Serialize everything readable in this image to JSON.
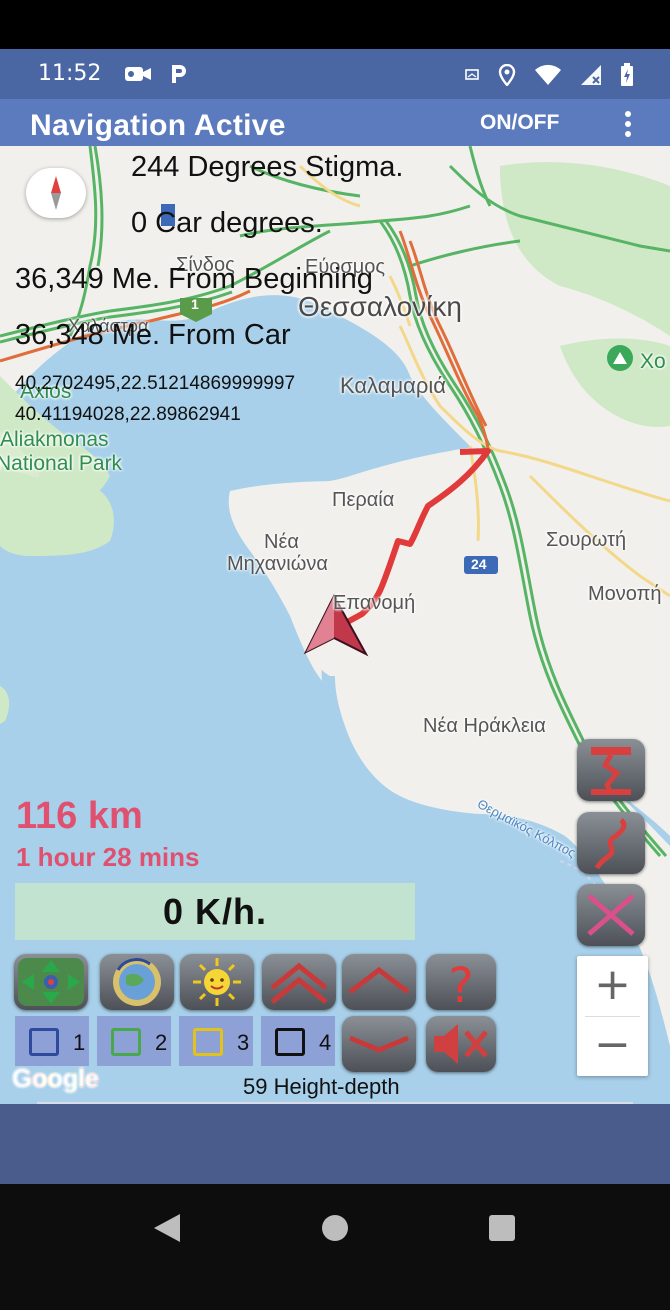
{
  "status_bar": {
    "time": "11:52",
    "left_icons": [
      "video-camera-icon",
      "parking-icon"
    ],
    "right_icons": [
      "cast-icon",
      "location-icon",
      "wifi-icon",
      "signal-icon",
      "battery-icon"
    ]
  },
  "app_bar": {
    "title": "Navigation Active",
    "action_label": "ON/OFF",
    "overflow_icon": "more-vert-icon",
    "color": "#5c7bbf"
  },
  "overlay": {
    "degrees_stigma": "244 Degrees Stigma.",
    "car_degrees": "0 Car degrees.",
    "from_beginning": "36,349 Me. From Beginning",
    "from_car": "36,348 Me. From Car",
    "coord_1": "40,2702495,22.51214869999997",
    "coord_2": "40.41194028,22.89862941"
  },
  "map": {
    "places": {
      "sindos": "Σίνδος",
      "evosmos": "Εύοσμος",
      "thessaloniki": "Θεσσαλονίκη",
      "kalamaria": "Καλαμαριά",
      "chalastra": "Χαλάστρα",
      "axios": "Axios",
      "axios2": "Aliakmonas",
      "national_park": "National Park",
      "peraia": "Περαία",
      "nea": "Νέα",
      "michaniona": "Μηχανιώνα",
      "epanomi": "Επανομή",
      "sourototi": "Σουρωτή",
      "monopigado": "Μονοπή",
      "nea_irakleia": "Νέα Ηράκλεια",
      "thermaikos": "Θερμαϊκός Κόλπος",
      "chortiatis": "Χο",
      "road_1": "1",
      "road_24": "24"
    },
    "route_color": "#e03a3a"
  },
  "trip": {
    "distance": "116 km",
    "duration": "1 hour 28 mins",
    "speed": "0  K/h."
  },
  "toolbar": {
    "row1": [
      "center-map-icon",
      "rotate-globe-icon",
      "sun-icon",
      "double-chevron-up-icon",
      "chevron-up-icon",
      "help-icon"
    ],
    "row2_checks": [
      {
        "label": "1",
        "color": "#2e4a9c"
      },
      {
        "label": "2",
        "color": "#49a84a"
      },
      {
        "label": "3",
        "color": "#e3c21b"
      },
      {
        "label": "4",
        "color": "#111111"
      }
    ],
    "row2_buttons": [
      "chevron-down-icon",
      "mute-icon"
    ]
  },
  "side_buttons": [
    "route-start-icon",
    "route-path-icon",
    "clear-route-icon"
  ],
  "zoom": {
    "in": "+",
    "out": "−"
  },
  "footer": {
    "google": "Google",
    "height_depth": "59 Height-depth"
  },
  "nav": [
    "back-icon",
    "home-icon",
    "recents-icon"
  ]
}
